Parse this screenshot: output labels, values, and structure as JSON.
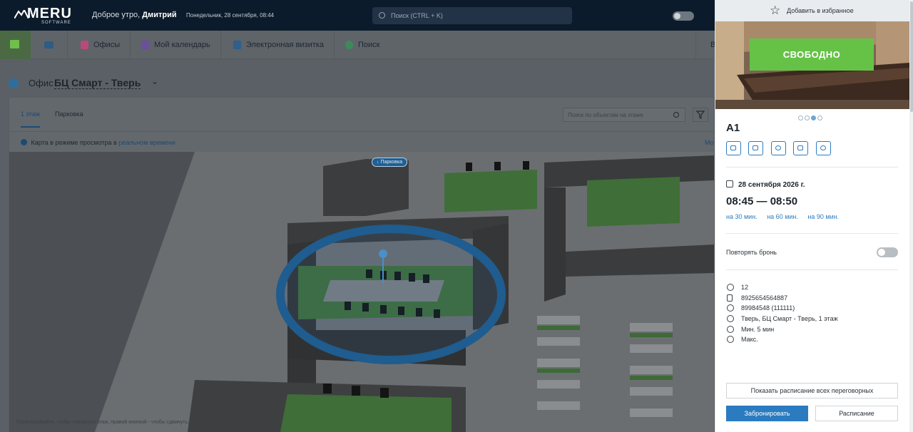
{
  "header": {
    "logo_text": "MERU",
    "logo_sub": "SOFTWARE",
    "greeting": "Доброе утро,",
    "user_name": "Дмитрий",
    "date_line": "Понедельник, 28 сентября, 08:44",
    "search_placeholder": "Поиск (CTRL + K)"
  },
  "nav": {
    "items": [
      {
        "label": "Офисы",
        "icon": "office-icon",
        "color": "#d15c8c"
      },
      {
        "label": "Мой календарь",
        "icon": "calendar-icon",
        "color": "#7b5cb0"
      },
      {
        "label": "Электронная визитка",
        "icon": "card-icon",
        "color": "#3a6d9c"
      },
      {
        "label": "Поиск",
        "icon": "search-icon",
        "color": "#4aa069"
      }
    ],
    "right_trunc": "В"
  },
  "office": {
    "label": "Офис",
    "name": "БЦ Смарт - Тверь",
    "tabs": [
      "1 этаж",
      "Парковка"
    ],
    "object_search_placeholder": "Поиск по объектам на этаже",
    "info_text": "Карта в режиме просмотра в",
    "info_link": "реальном времени",
    "info_right": "Мо",
    "parking_tag": "↓ Парковка",
    "hint": "Перетаскивайте, чтобы повернуть этаж, правой кнопкой - чтобы сдвинуть, двойной клик в пустое место"
  },
  "card": {
    "favorite_label": "Добавить в избранное",
    "status": "СВОБОДНО",
    "status_color": "#66c247",
    "name": "A1",
    "date": "28 сентября 2026 г.",
    "time_range": "08:45 — 08:50",
    "quick_durations": [
      "на 30 мин.",
      "на 60 мин.",
      "на 90 мин."
    ],
    "repeat_label": "Повторять бронь",
    "props": [
      {
        "icon": "people-icon",
        "text": "12"
      },
      {
        "icon": "phone-icon",
        "text": "8925654564887"
      },
      {
        "icon": "wifi-icon",
        "text": "89984548  (111111)"
      },
      {
        "icon": "location-icon",
        "text": "Тверь, БЦ Смарт - Тверь, 1 этаж"
      },
      {
        "icon": "clock-icon",
        "text": "Мин. 5 мин"
      },
      {
        "icon": "clock-icon",
        "text": "Макс."
      }
    ],
    "show_all_label": "Показать расписание всех переговорных",
    "book_label": "Забронировать",
    "schedule_label": "Расписание",
    "accent_color": "#2b7bc0"
  }
}
